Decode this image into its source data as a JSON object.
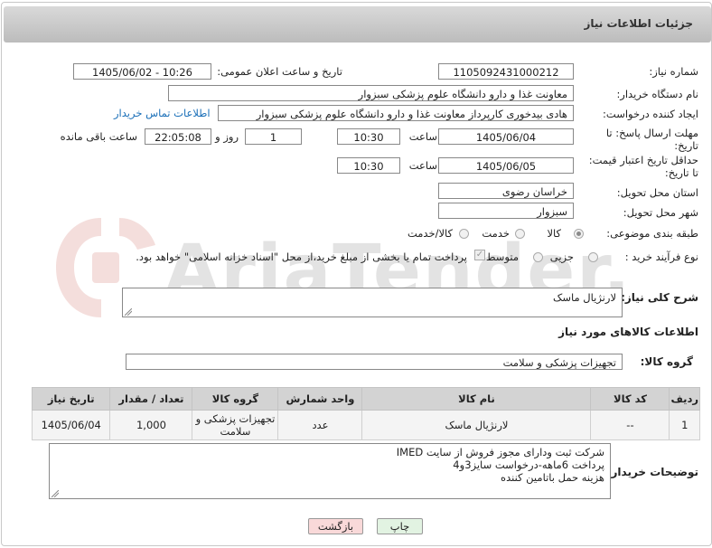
{
  "header": {
    "title": "جزئیات اطلاعات نیاز"
  },
  "form": {
    "need_number_label": "شماره نیاز:",
    "need_number_value": "1105092431000212",
    "announce_label": "تاریخ و ساعت اعلان عمومی:",
    "announce_value": "1405/06/02 - 10:26",
    "buyer_org_label": "نام دستگاه خریدار:",
    "buyer_org_value": "معاونت غذا و دارو   دانشگاه علوم پزشکی سبزوار",
    "creator_label": "ایجاد کننده درخواست:",
    "creator_value": "هادی بیدخوری کارپرداز معاونت غذا و دارو   دانشگاه علوم پزشکی سبزوار",
    "contact_link": "اطلاعات تماس خریدار",
    "deadline_label_1": "مهلت ارسال پاسخ: تا",
    "deadline_label_2": "تاریخ:",
    "deadline_date": "1405/06/04",
    "time_label": "ساعت",
    "deadline_time": "10:30",
    "days_value": "1",
    "days_label": "روز و",
    "remaining_time": "22:05:08",
    "remaining_label": "ساعت باقی مانده",
    "price_validity_label_1": "حداقل تاریخ اعتبار قیمت:",
    "price_validity_label_2": "تا تاریخ:",
    "price_validity_date": "1405/06/05",
    "price_validity_time": "10:30",
    "province_label": "استان محل تحویل:",
    "province_value": "خراسان رضوی",
    "city_label": "شهر محل تحویل:",
    "city_value": "سبزوار",
    "category_label": "طبقه بندی موضوعی:",
    "category_options": [
      "کالا",
      "خدمت",
      "کالا/خدمت"
    ],
    "category_selected": "کالا",
    "purchase_type_label": "نوع فرآیند خرید :",
    "purchase_options": [
      "جزیی",
      "متوسط"
    ],
    "payment_note": "پرداخت تمام یا بخشی از مبلغ خرید،از محل \"اسناد خزانه اسلامی\" خواهد بود."
  },
  "description": {
    "label": "شرح کلی نیاز:",
    "value": "لارنژیال ماسک"
  },
  "goods_info": {
    "title": "اطلاعات کالاهای مورد نیاز",
    "group_label": "گروه کالا:",
    "group_value": "تجهیزات پزشکی و سلامت"
  },
  "table": {
    "headers": [
      "ردیف",
      "کد کالا",
      "نام کالا",
      "واحد شمارش",
      "گروه کالا",
      "تعداد / مقدار",
      "تاریخ نیاز"
    ],
    "rows": [
      {
        "row": "1",
        "code": "--",
        "name": "لارنژیال ماسک",
        "unit": "عدد",
        "group": "تجهیزات پزشکی و سلامت",
        "qty": "1,000",
        "date": "1405/06/04"
      }
    ]
  },
  "buyer_notes": {
    "label": "توضیحات خریدار:",
    "lines": [
      "شرکت ثبت ودارای مجوز فروش از سایت IMED",
      "پرداخت 6ماهه-درخواست سایز3و4",
      "هزینه حمل باتامین کننده"
    ]
  },
  "buttons": {
    "print": "چاپ",
    "back": "بازگشت"
  },
  "watermark": {
    "text": "AriaTender.neT"
  },
  "colors": {
    "link": "#1a6fb8",
    "header_bg": "#c9c9c9",
    "back_button_bg": "#f9d9d9",
    "print_button_bg": "#e2f3e2"
  }
}
